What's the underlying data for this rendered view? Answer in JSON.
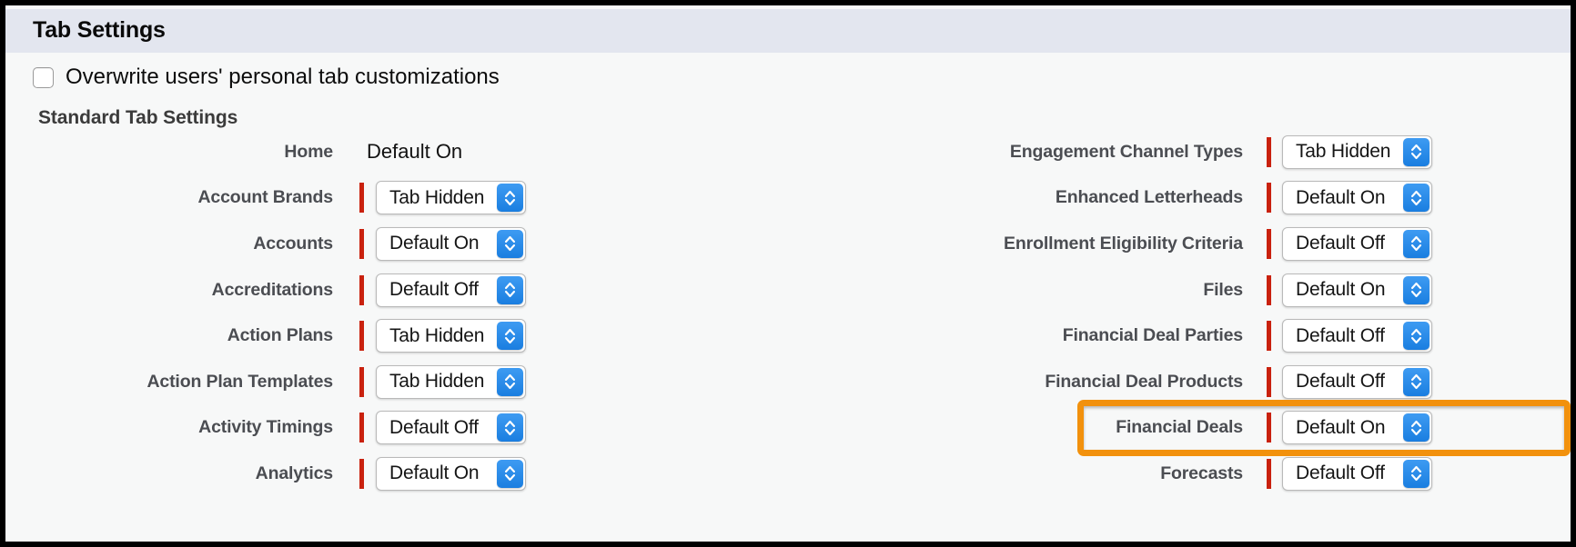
{
  "section": {
    "title": "Tab Settings"
  },
  "overwrite": {
    "label": "Overwrite users' personal tab customizations",
    "checked": false,
    "icon": "checkbox-unchecked-icon"
  },
  "standard_tab_settings": {
    "heading": "Standard Tab Settings",
    "left_column": [
      {
        "label": "Home",
        "value": "Default On",
        "control": "text"
      },
      {
        "label": "Account Brands",
        "value": "Tab Hidden",
        "control": "select"
      },
      {
        "label": "Accounts",
        "value": "Default On",
        "control": "select"
      },
      {
        "label": "Accreditations",
        "value": "Default Off",
        "control": "select"
      },
      {
        "label": "Action Plans",
        "value": "Tab Hidden",
        "control": "select"
      },
      {
        "label": "Action Plan Templates",
        "value": "Tab Hidden",
        "control": "select"
      },
      {
        "label": "Activity Timings",
        "value": "Default Off",
        "control": "select"
      },
      {
        "label": "Analytics",
        "value": "Default On",
        "control": "select"
      }
    ],
    "right_column": [
      {
        "label": "Engagement Channel Types",
        "value": "Tab Hidden",
        "control": "select"
      },
      {
        "label": "Enhanced Letterheads",
        "value": "Default On",
        "control": "select"
      },
      {
        "label": "Enrollment Eligibility Criteria",
        "value": "Default Off",
        "control": "select"
      },
      {
        "label": "Files",
        "value": "Default On",
        "control": "select"
      },
      {
        "label": "Financial Deal Parties",
        "value": "Default Off",
        "control": "select"
      },
      {
        "label": "Financial Deal Products",
        "value": "Default Off",
        "control": "select"
      },
      {
        "label": "Financial Deals",
        "value": "Default On",
        "control": "select",
        "highlighted": true
      },
      {
        "label": "Forecasts",
        "value": "Default Off",
        "control": "select"
      }
    ]
  },
  "select_options": [
    "Default On",
    "Default Off",
    "Tab Hidden"
  ],
  "colors": {
    "header_band": "#e3e6ef",
    "page_background": "#f7f8f8",
    "required_bar": "#c9210e",
    "highlight_border": "#f2910d",
    "stepper_blue": "#1a7ee0",
    "label_text": "#4b4d52"
  }
}
